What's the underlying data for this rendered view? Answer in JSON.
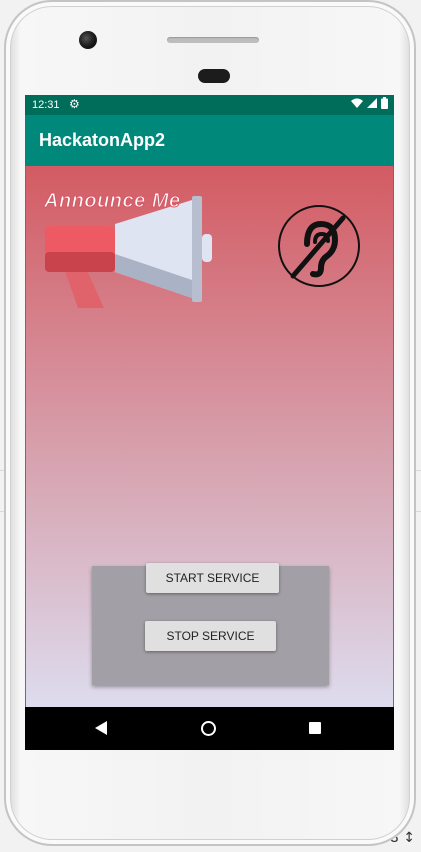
{
  "status_bar": {
    "time": "12:31",
    "settings_icon": "gear-icon",
    "wifi_icon": "wifi-icon",
    "signal_icon": "signal-icon",
    "battery_icon": "battery-icon"
  },
  "app_bar": {
    "title": "HackatonApp2"
  },
  "logo": {
    "text": "Announce Me",
    "icon": "megaphone-icon"
  },
  "deaf_icon": "hearing-disabled-icon",
  "panel": {
    "start_label": "START SERVICE",
    "stop_label": "STOP SERVICE"
  },
  "nav_bar": {
    "back_icon": "back-icon",
    "home_icon": "home-icon",
    "recents_icon": "recents-icon"
  },
  "background_corner_text": "8 ↕",
  "colors": {
    "status_bar": "#006d5b",
    "app_bar": "#00897b",
    "gradient_top": "#d35b63",
    "gradient_bottom": "#dddcee",
    "panel": "#a39fa6"
  }
}
